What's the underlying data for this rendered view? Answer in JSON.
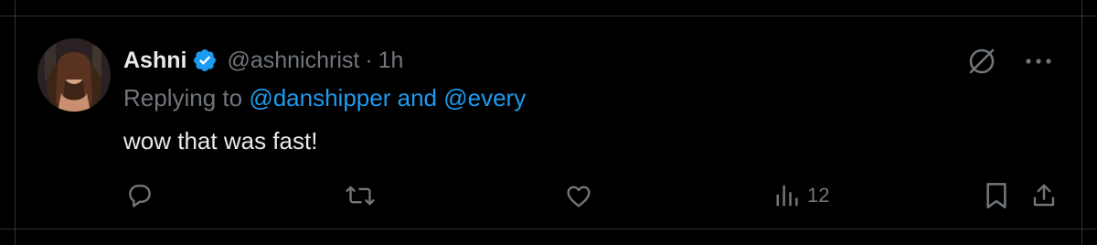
{
  "tweet": {
    "author_name": "Ashni",
    "handle": "@ashnichrist",
    "separator": "·",
    "time": "1h",
    "replying_prefix": "Replying to",
    "reply_mentions": [
      "@danshipper",
      "@every"
    ],
    "reply_conjunction": "and",
    "text": "wow that was fast!",
    "verified": true
  },
  "actions": {
    "reply_icon": "reply-icon",
    "retweet_icon": "retweet-icon",
    "like_icon": "like-icon",
    "views_icon": "views-icon",
    "views_count": "12",
    "bookmark_icon": "bookmark-icon",
    "share_icon": "share-icon"
  },
  "top_actions": {
    "grok_icon": "grok-icon",
    "more_icon": "more-icon"
  },
  "colors": {
    "background": "#000000",
    "primary_text": "#e7e9ea",
    "secondary_text": "#71767b",
    "accent": "#1d9bf0",
    "divider": "#2f3336"
  }
}
